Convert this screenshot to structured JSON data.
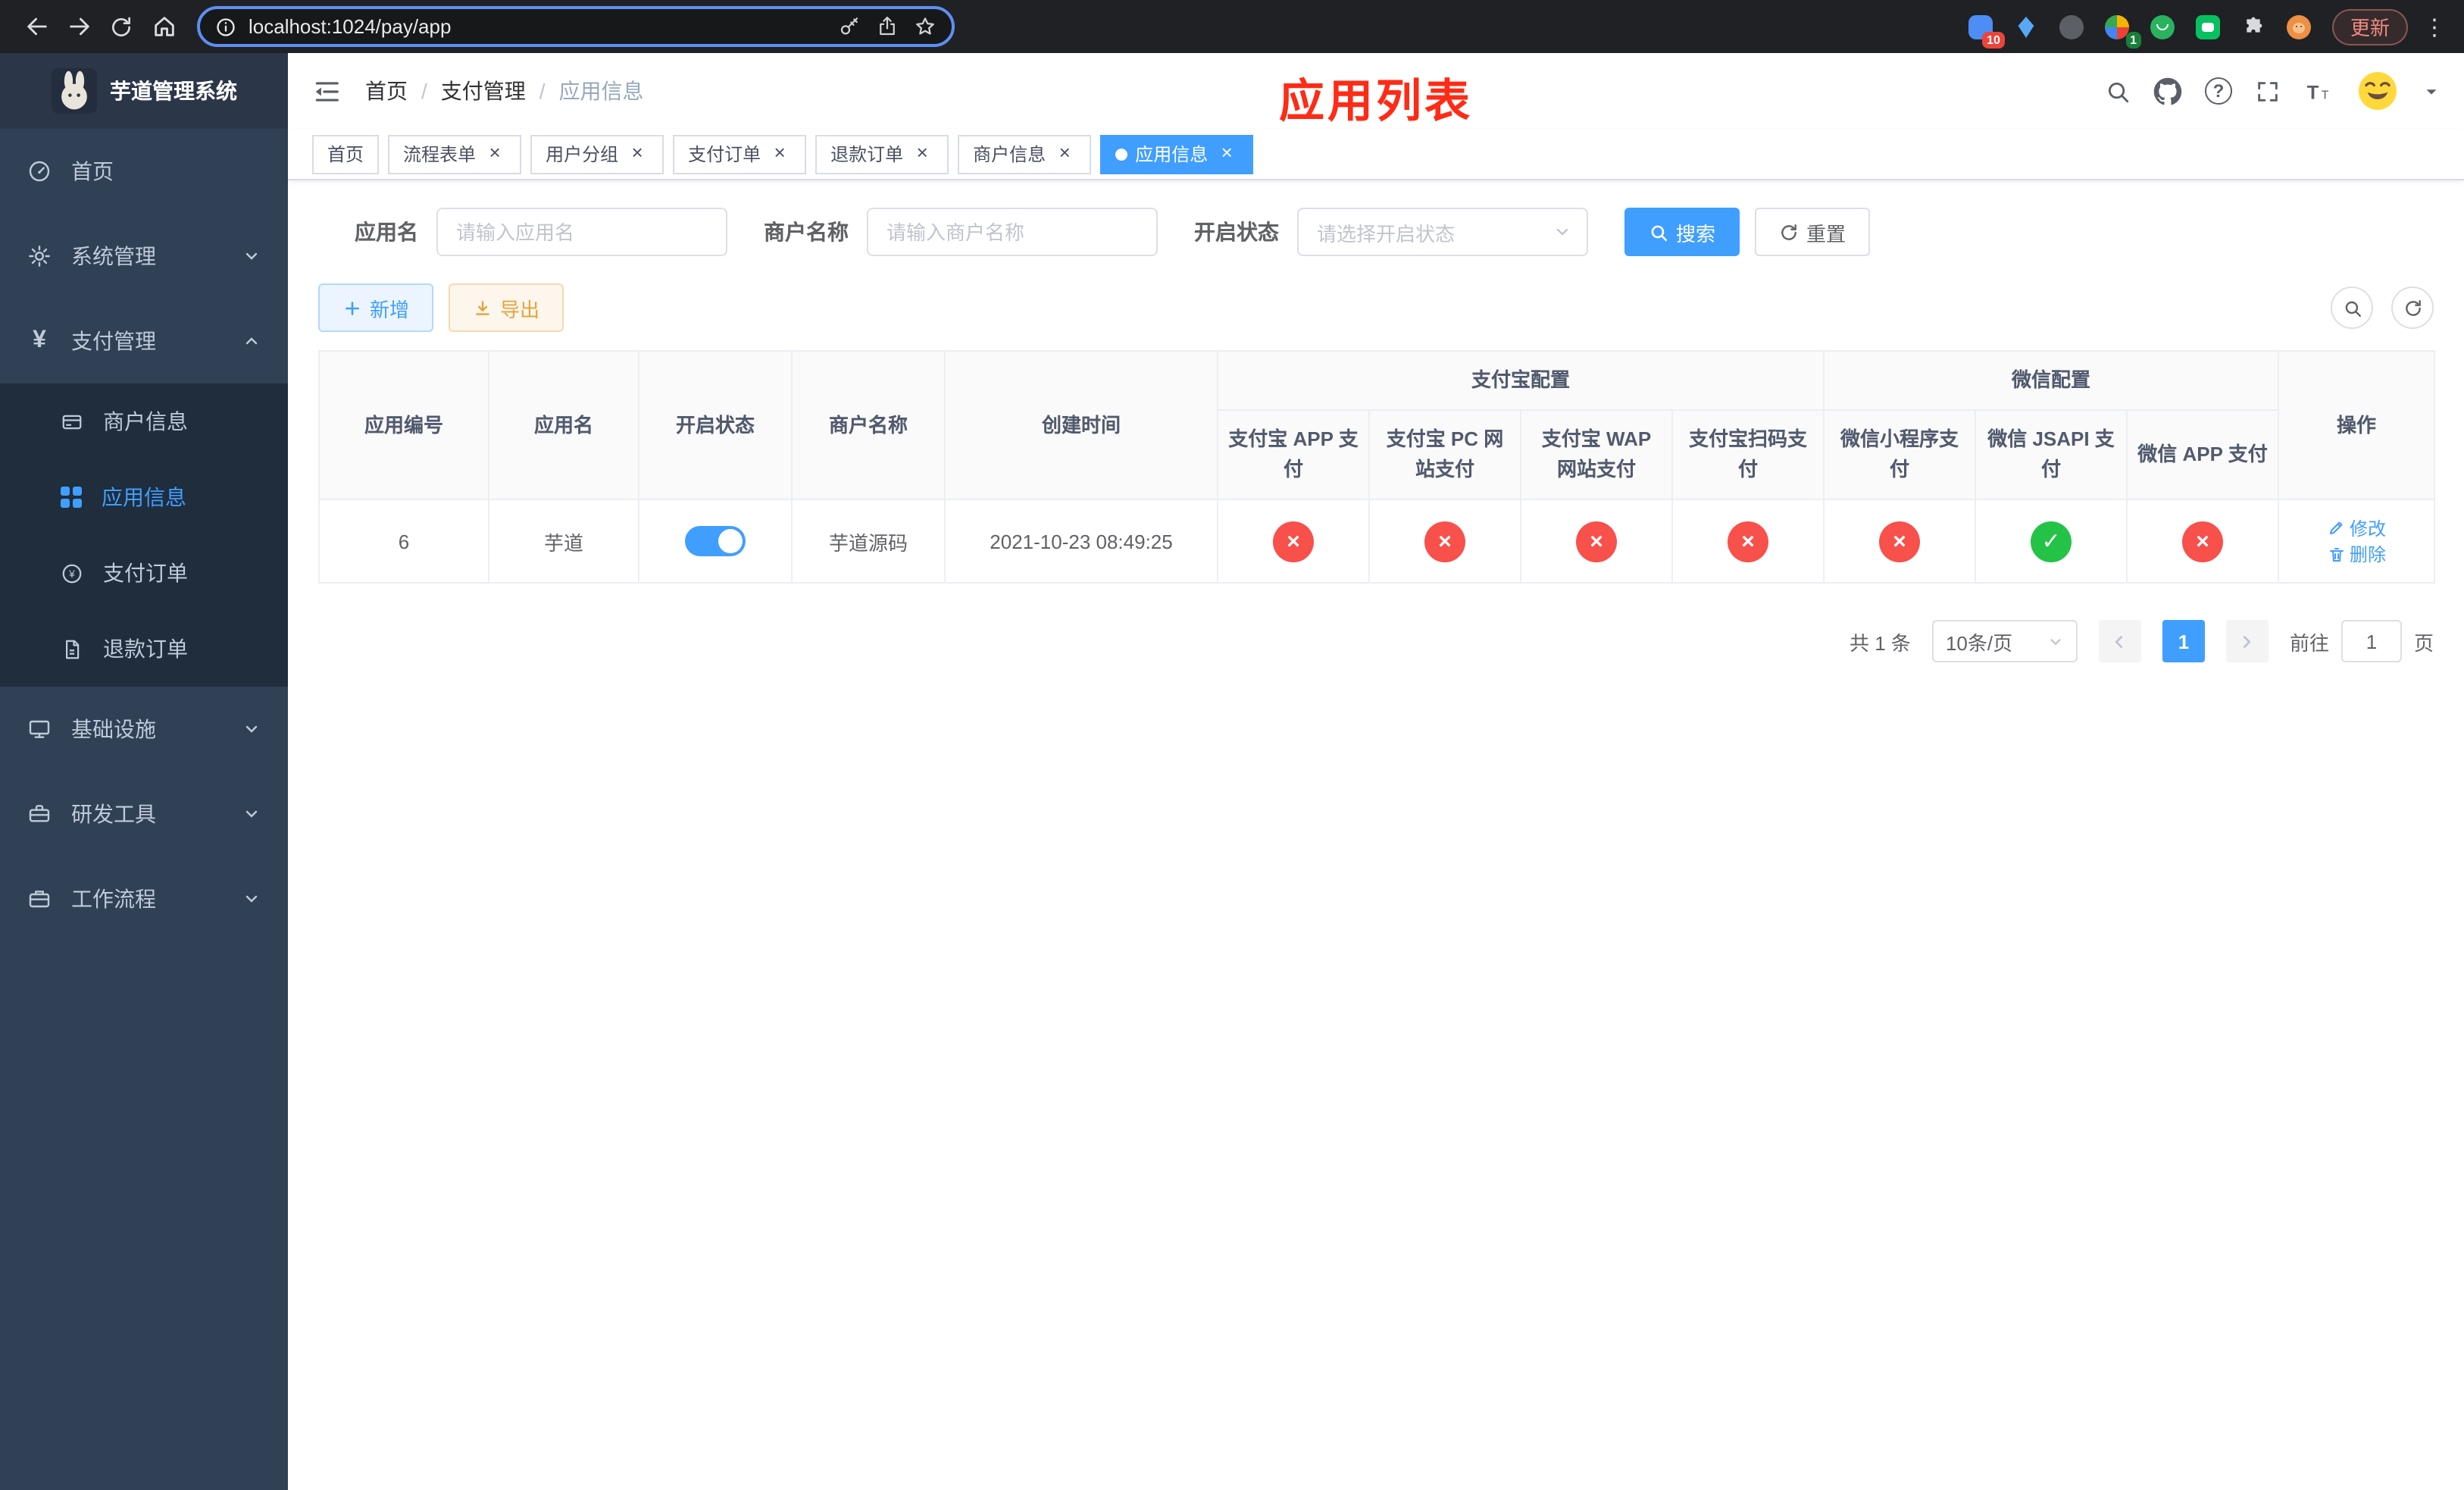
{
  "colors": {
    "accent": "#409eff",
    "danger": "#f8504b",
    "success": "#25c248",
    "warning": "#e6a23c",
    "annotation": "#fe2b16"
  },
  "browser": {
    "url": "localhost:1024/pay/app",
    "update_button": "更新",
    "ext_badge_1": "10",
    "ext_badge_2": "1"
  },
  "sidebar": {
    "logo_title": "芋道管理系统",
    "home": "首页",
    "system": "系统管理",
    "payment": "支付管理",
    "merchant_info": "商户信息",
    "app_info": "应用信息",
    "pay_order": "支付订单",
    "refund_order": "退款订单",
    "infra": "基础设施",
    "dev_tools": "研发工具",
    "workflow": "工作流程"
  },
  "navbar": {
    "breadcrumb": [
      "首页",
      "支付管理",
      "应用信息"
    ],
    "annotation": "应用列表"
  },
  "tabs": [
    {
      "label": "首页"
    },
    {
      "label": "流程表单"
    },
    {
      "label": "用户分组"
    },
    {
      "label": "支付订单"
    },
    {
      "label": "退款订单"
    },
    {
      "label": "商户信息"
    },
    {
      "label": "应用信息"
    }
  ],
  "filters": {
    "app_name_label": "应用名",
    "app_name_placeholder": "请输入应用名",
    "merchant_label": "商户名称",
    "merchant_placeholder": "请输入商户名称",
    "status_label": "开启状态",
    "status_placeholder": "请选择开启状态",
    "search_button": "搜索",
    "reset_button": "重置"
  },
  "toolbar": {
    "add_button": "新增",
    "export_button": "导出"
  },
  "table": {
    "group_headers": {
      "alipay": "支付宝配置",
      "wechat": "微信配置"
    },
    "columns": [
      "应用编号",
      "应用名",
      "开启状态",
      "商户名称",
      "创建时间",
      "支付宝 APP 支付",
      "支付宝 PC 网站支付",
      "支付宝 WAP 网站支付",
      "支付宝扫码支付",
      "微信小程序支付",
      "微信 JSAPI 支付",
      "微信 APP 支付",
      "操作"
    ],
    "rows": [
      {
        "id": "6",
        "app_name": "芋道",
        "status_on": true,
        "merchant": "芋道源码",
        "created_at": "2021-10-23 08:49:25",
        "configs": [
          "no",
          "no",
          "no",
          "no",
          "no",
          "yes",
          "no"
        ],
        "actions": {
          "edit": "修改",
          "delete": "删除"
        }
      }
    ]
  },
  "pagination": {
    "total": "共 1 条",
    "page_size": "10条/页",
    "current_page": "1",
    "goto_label": "前往",
    "goto_value": "1",
    "page_unit": "页"
  }
}
